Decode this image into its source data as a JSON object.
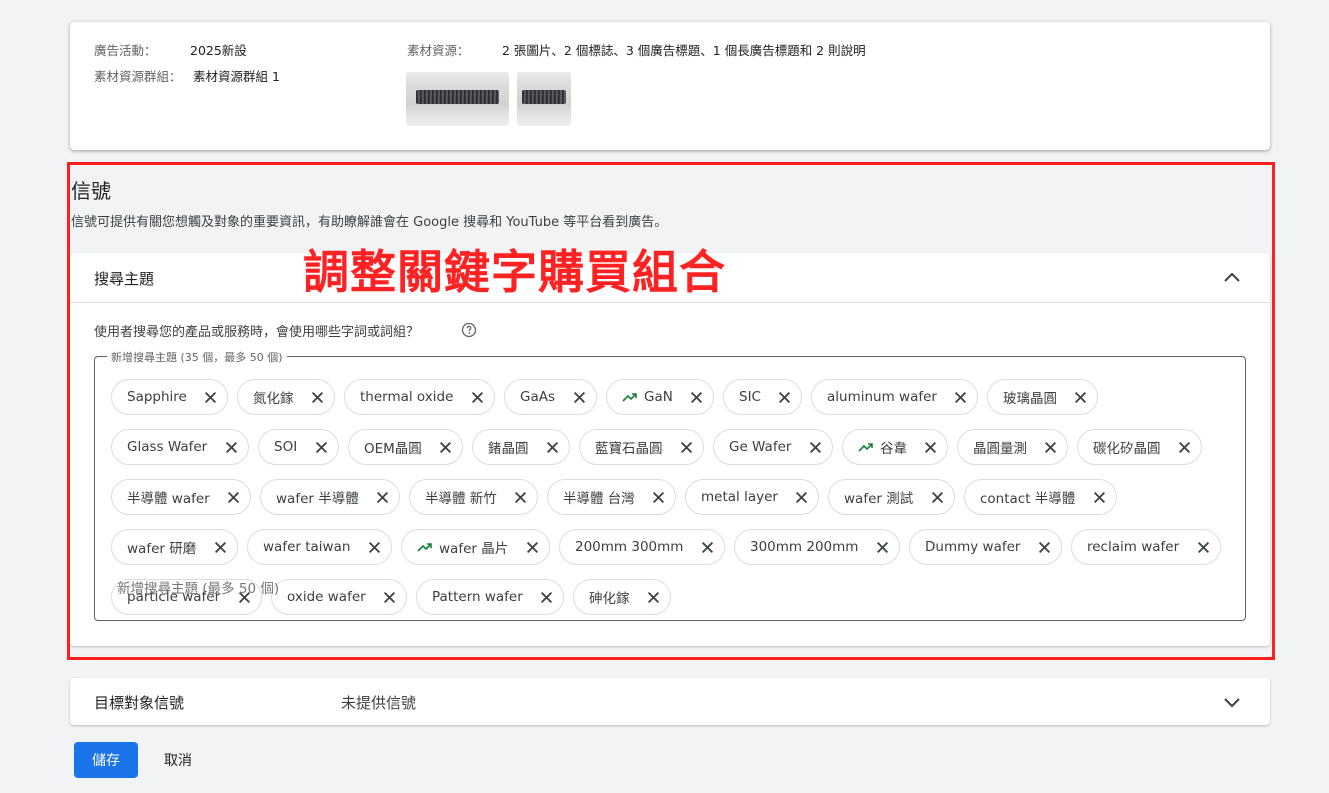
{
  "summary": {
    "campaign_label": "廣告活動：",
    "campaign_value": "2025新設",
    "asset_group_label": "素材資源群組：",
    "asset_group_value": "素材資源群組 1",
    "assets_label": "素材資源：",
    "assets_value": "2 張圖片、2 個標誌、3 個廣告標題、1 個長廣告標題和 2 則說明"
  },
  "signals": {
    "title": "信號",
    "description": "信號可提供有關您想觸及對象的重要資訊，有助瞭解誰會在 Google 搜尋和 YouTube 等平台看到廣告。"
  },
  "annotation": "調整關鍵字購買組合",
  "search_topics": {
    "title": "搜尋主題",
    "question": "使用者搜尋您的產品或服務時，會使用哪些字詞或詞組？",
    "legend": "新增搜尋主題 (35 個，最多 50 個)",
    "add_placeholder": "新增搜尋主題 (最多 50 個)",
    "chips": [
      {
        "label": "Sapphire",
        "trending": false
      },
      {
        "label": "氮化鎵",
        "trending": false
      },
      {
        "label": "thermal oxide",
        "trending": false
      },
      {
        "label": "GaAs",
        "trending": false
      },
      {
        "label": "GaN",
        "trending": true
      },
      {
        "label": "SIC",
        "trending": false
      },
      {
        "label": "aluminum wafer",
        "trending": false
      },
      {
        "label": "玻璃晶圓",
        "trending": false
      },
      {
        "label": "Glass Wafer",
        "trending": false
      },
      {
        "label": "SOI",
        "trending": false
      },
      {
        "label": "OEM晶圓",
        "trending": false
      },
      {
        "label": "鍺晶圓",
        "trending": false
      },
      {
        "label": "藍寶石晶圓",
        "trending": false
      },
      {
        "label": "Ge Wafer",
        "trending": false
      },
      {
        "label": "谷韋",
        "trending": true
      },
      {
        "label": "晶圓量測",
        "trending": false
      },
      {
        "label": "碳化矽晶圓",
        "trending": false
      },
      {
        "label": "半導體 wafer",
        "trending": false
      },
      {
        "label": "wafer 半導體",
        "trending": false
      },
      {
        "label": "半導體 新竹",
        "trending": false
      },
      {
        "label": "半導體 台灣",
        "trending": false
      },
      {
        "label": "metal layer",
        "trending": false
      },
      {
        "label": "wafer 測試",
        "trending": false
      },
      {
        "label": "contact 半導體",
        "trending": false
      },
      {
        "label": "wafer 研磨",
        "trending": false
      },
      {
        "label": "wafer taiwan",
        "trending": false
      },
      {
        "label": "wafer 晶片",
        "trending": true
      },
      {
        "label": "200mm 300mm",
        "trending": false
      },
      {
        "label": "300mm 200mm",
        "trending": false
      },
      {
        "label": "Dummy wafer",
        "trending": false
      },
      {
        "label": "reclaim wafer",
        "trending": false
      },
      {
        "label": "particle wafer",
        "trending": false
      },
      {
        "label": "oxide wafer",
        "trending": false
      },
      {
        "label": "Pattern wafer",
        "trending": false
      },
      {
        "label": "砷化鎵",
        "trending": false
      }
    ]
  },
  "audience": {
    "title": "目標對象信號",
    "value": "未提供信號"
  },
  "actions": {
    "save": "儲存",
    "cancel": "取消"
  },
  "colors": {
    "primary": "#1a73e8",
    "annotation": "#ff2222",
    "trend": "#188038"
  }
}
